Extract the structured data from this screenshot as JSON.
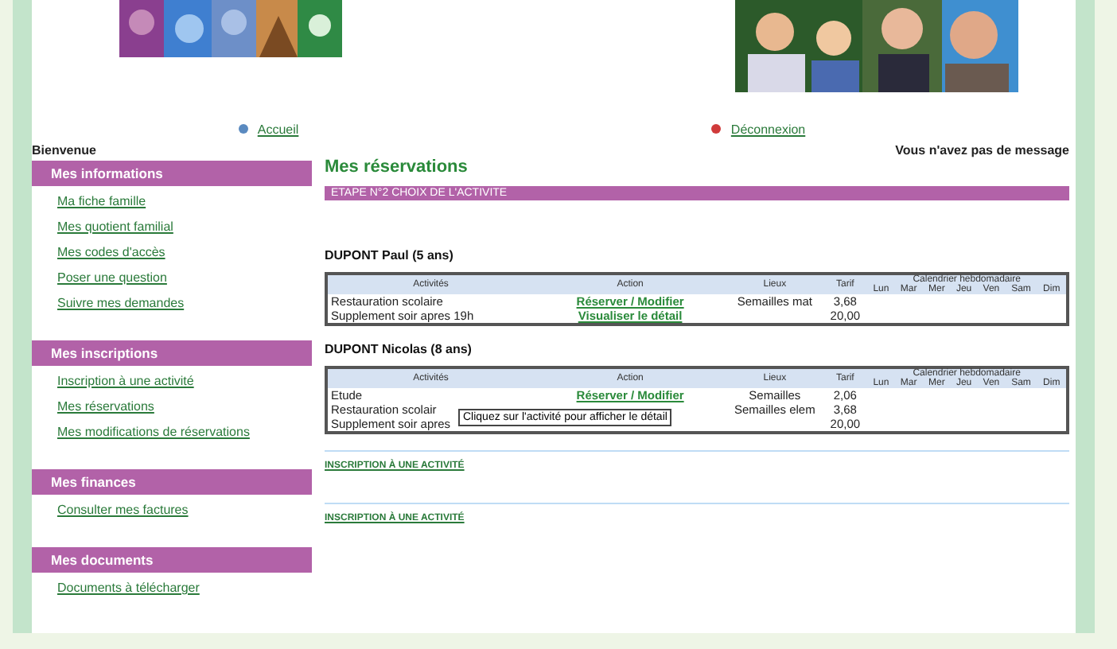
{
  "nav": {
    "home": "Accueil",
    "logout": "Déconnexion"
  },
  "welcome": "Bienvenue",
  "message": "Vous n'avez pas de message",
  "sidebar": [
    {
      "title": "Mes informations",
      "items": [
        "Ma fiche famille",
        "Mes quotient familial",
        "Mes codes d'accès",
        "Poser une question",
        "Suivre mes demandes"
      ]
    },
    {
      "title": "Mes inscriptions",
      "items": [
        "Inscription à une activité",
        "Mes réservations",
        "Mes modifications de réservations"
      ]
    },
    {
      "title": "Mes finances",
      "items": [
        "Consulter mes factures"
      ]
    },
    {
      "title": "Mes documents",
      "items": [
        "Documents à télécharger"
      ]
    }
  ],
  "page_title": "Mes réservations",
  "step": "ETAPE N°2 CHOIX DE L'ACTIVITE",
  "children": [
    {
      "name": "DUPONT Paul (5 ans)",
      "columns": [
        "Activités",
        "Action",
        "Lieux",
        "Tarif"
      ],
      "calendar": {
        "title": "Calendrier hebdomadaire",
        "days": [
          "Lun",
          "Mar",
          "Mer",
          "Jeu",
          "Ven",
          "Sam",
          "Dim"
        ]
      },
      "rows": [
        {
          "activity": "Restauration scolaire",
          "action": "Réserver / Modifier",
          "place": "Semailles mat",
          "price": "3,68"
        },
        {
          "activity": "Supplement soir apres 19h",
          "action": "Visualiser le détail",
          "price": "20,00"
        }
      ]
    },
    {
      "name": "DUPONT Nicolas (8 ans)",
      "columns": [
        "Activités",
        "Action",
        "Lieux",
        "Tarif"
      ],
      "calendar": {
        "title": "Calendrier hebdomadaire",
        "days": [
          "Lun",
          "Mar",
          "Mer",
          "Jeu",
          "Ven",
          "Sam",
          "Dim"
        ]
      },
      "rows": [
        {
          "activity": "Etude",
          "action": "Réserver / Modifier",
          "place": "Semailles",
          "price": "2,06"
        },
        {
          "activity": "Restauration scolair",
          "place": "Semailles elem",
          "price": "3,68"
        },
        {
          "activity": "Supplement soir apres",
          "price": "20,00"
        }
      ],
      "tooltip": "Cliquez sur l'activité pour afficher le détail"
    }
  ],
  "links": [
    "INSCRIPTION À UNE ACTIVITÉ",
    "INSCRIPTION À UNE ACTIVITÉ"
  ]
}
